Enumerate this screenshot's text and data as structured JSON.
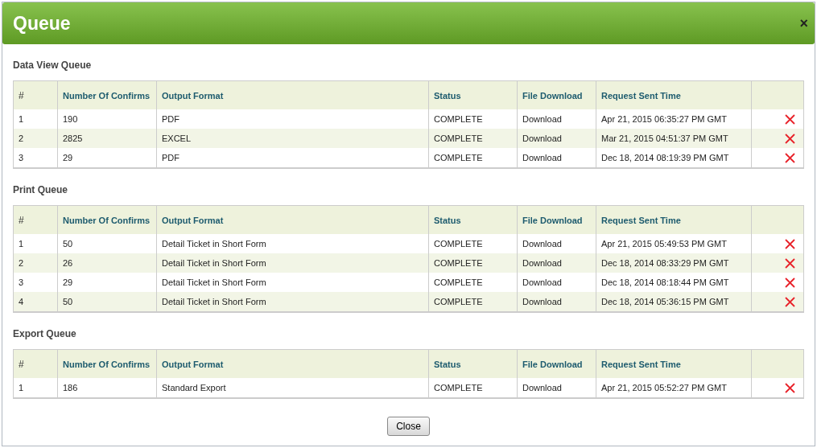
{
  "dialog": {
    "title": "Queue",
    "close_icon": "×"
  },
  "sections": [
    {
      "title": "Data View Queue",
      "columns": [
        "#",
        "Number Of Confirms",
        "Output Format",
        "Status",
        "File Download",
        "Request Sent Time"
      ],
      "rows": [
        {
          "index": "1",
          "confirms": "190",
          "format": "PDF",
          "status": "COMPLETE",
          "download": "Download",
          "time": "Apr 21, 2015 06:35:27 PM GMT"
        },
        {
          "index": "2",
          "confirms": "2825",
          "format": "EXCEL",
          "status": "COMPLETE",
          "download": "Download",
          "time": "Mar 21, 2015 04:51:37 PM GMT"
        },
        {
          "index": "3",
          "confirms": "29",
          "format": "PDF",
          "status": "COMPLETE",
          "download": "Download",
          "time": "Dec 18, 2014 08:19:39 PM GMT"
        }
      ]
    },
    {
      "title": "Print Queue",
      "columns": [
        "#",
        "Number Of Confirms",
        "Output Format",
        "Status",
        "File Download",
        "Request Sent Time"
      ],
      "rows": [
        {
          "index": "1",
          "confirms": "50",
          "format": "Detail Ticket in Short Form",
          "status": "COMPLETE",
          "download": "Download",
          "time": "Apr 21, 2015 05:49:53 PM GMT"
        },
        {
          "index": "2",
          "confirms": "26",
          "format": "Detail Ticket in Short Form",
          "status": "COMPLETE",
          "download": "Download",
          "time": "Dec 18, 2014 08:33:29 PM GMT"
        },
        {
          "index": "3",
          "confirms": "29",
          "format": "Detail Ticket in Short Form",
          "status": "COMPLETE",
          "download": "Download",
          "time": "Dec 18, 2014 08:18:44 PM GMT"
        },
        {
          "index": "4",
          "confirms": "50",
          "format": "Detail Ticket in Short Form",
          "status": "COMPLETE",
          "download": "Download",
          "time": "Dec 18, 2014 05:36:15 PM GMT"
        }
      ]
    },
    {
      "title": "Export Queue",
      "columns": [
        "#",
        "Number Of Confirms",
        "Output Format",
        "Status",
        "File Download",
        "Request Sent Time"
      ],
      "rows": [
        {
          "index": "1",
          "confirms": "186",
          "format": "Standard Export",
          "status": "COMPLETE",
          "download": "Download",
          "time": "Apr 21, 2015 05:52:27 PM GMT"
        }
      ]
    }
  ],
  "close_button": "Close"
}
